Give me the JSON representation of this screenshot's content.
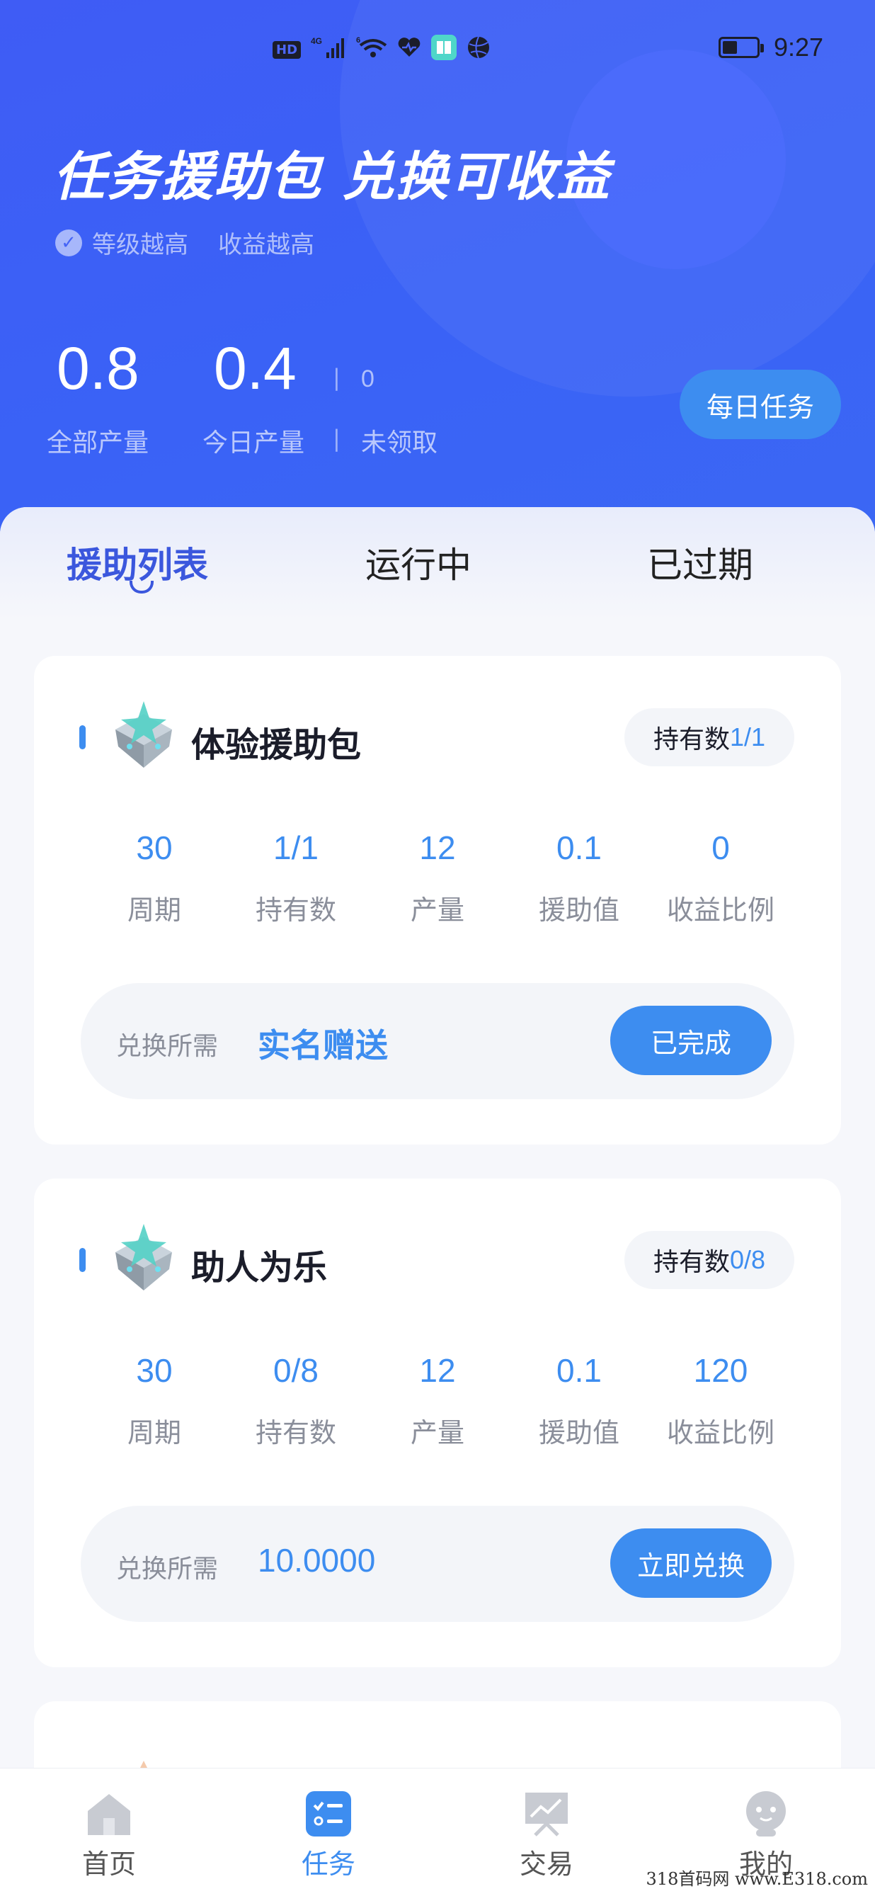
{
  "status_bar": {
    "network_label": "HD",
    "signal1": "4G",
    "signal2": "6",
    "time": "9:27"
  },
  "header": {
    "title": "任务援助包 兑换可收益",
    "subtitle_left": "等级越高",
    "subtitle_right": "收益越高",
    "total_output_value": "0.8",
    "total_output_label": "全部产量",
    "today_output_value": "0.4",
    "today_output_label": "今日产量",
    "unclaimed_value": "0",
    "unclaimed_label": "未领取",
    "separator": "|",
    "daily_task_button": "每日任务"
  },
  "tabs": [
    {
      "label": "援助列表",
      "active": true
    },
    {
      "label": "运行中",
      "active": false
    },
    {
      "label": "已过期",
      "active": false
    }
  ],
  "cards": [
    {
      "title": "体验援助包",
      "hold_label": "持有数",
      "hold_value": "1/1",
      "metrics": [
        {
          "value": "30",
          "label": "周期"
        },
        {
          "value": "1/1",
          "label": "持有数"
        },
        {
          "value": "12",
          "label": "产量"
        },
        {
          "value": "0.1",
          "label": "援助值"
        },
        {
          "value": "0",
          "label": "收益比例"
        }
      ],
      "redeem_label": "兑换所需",
      "redeem_value": "实名赠送",
      "button": "已完成"
    },
    {
      "title": "助人为乐",
      "hold_label": "持有数",
      "hold_value": "0/8",
      "metrics": [
        {
          "value": "30",
          "label": "周期"
        },
        {
          "value": "0/8",
          "label": "持有数"
        },
        {
          "value": "12",
          "label": "产量"
        },
        {
          "value": "0.1",
          "label": "援助值"
        },
        {
          "value": "120",
          "label": "收益比例"
        }
      ],
      "redeem_label": "兑换所需",
      "redeem_value": "10.0000",
      "button": "立即兑换"
    }
  ],
  "bottom_nav": [
    {
      "label": "首页",
      "icon": "home-icon",
      "active": false
    },
    {
      "label": "任务",
      "icon": "task-icon",
      "active": true
    },
    {
      "label": "交易",
      "icon": "trade-icon",
      "active": false
    },
    {
      "label": "我的",
      "icon": "profile-icon",
      "active": false
    }
  ],
  "watermark": "318首码网 www.E318.com",
  "colors": {
    "header_blue": "#3f5cf5",
    "accent_blue": "#3d8df0",
    "tab_active": "#3b57dd"
  }
}
